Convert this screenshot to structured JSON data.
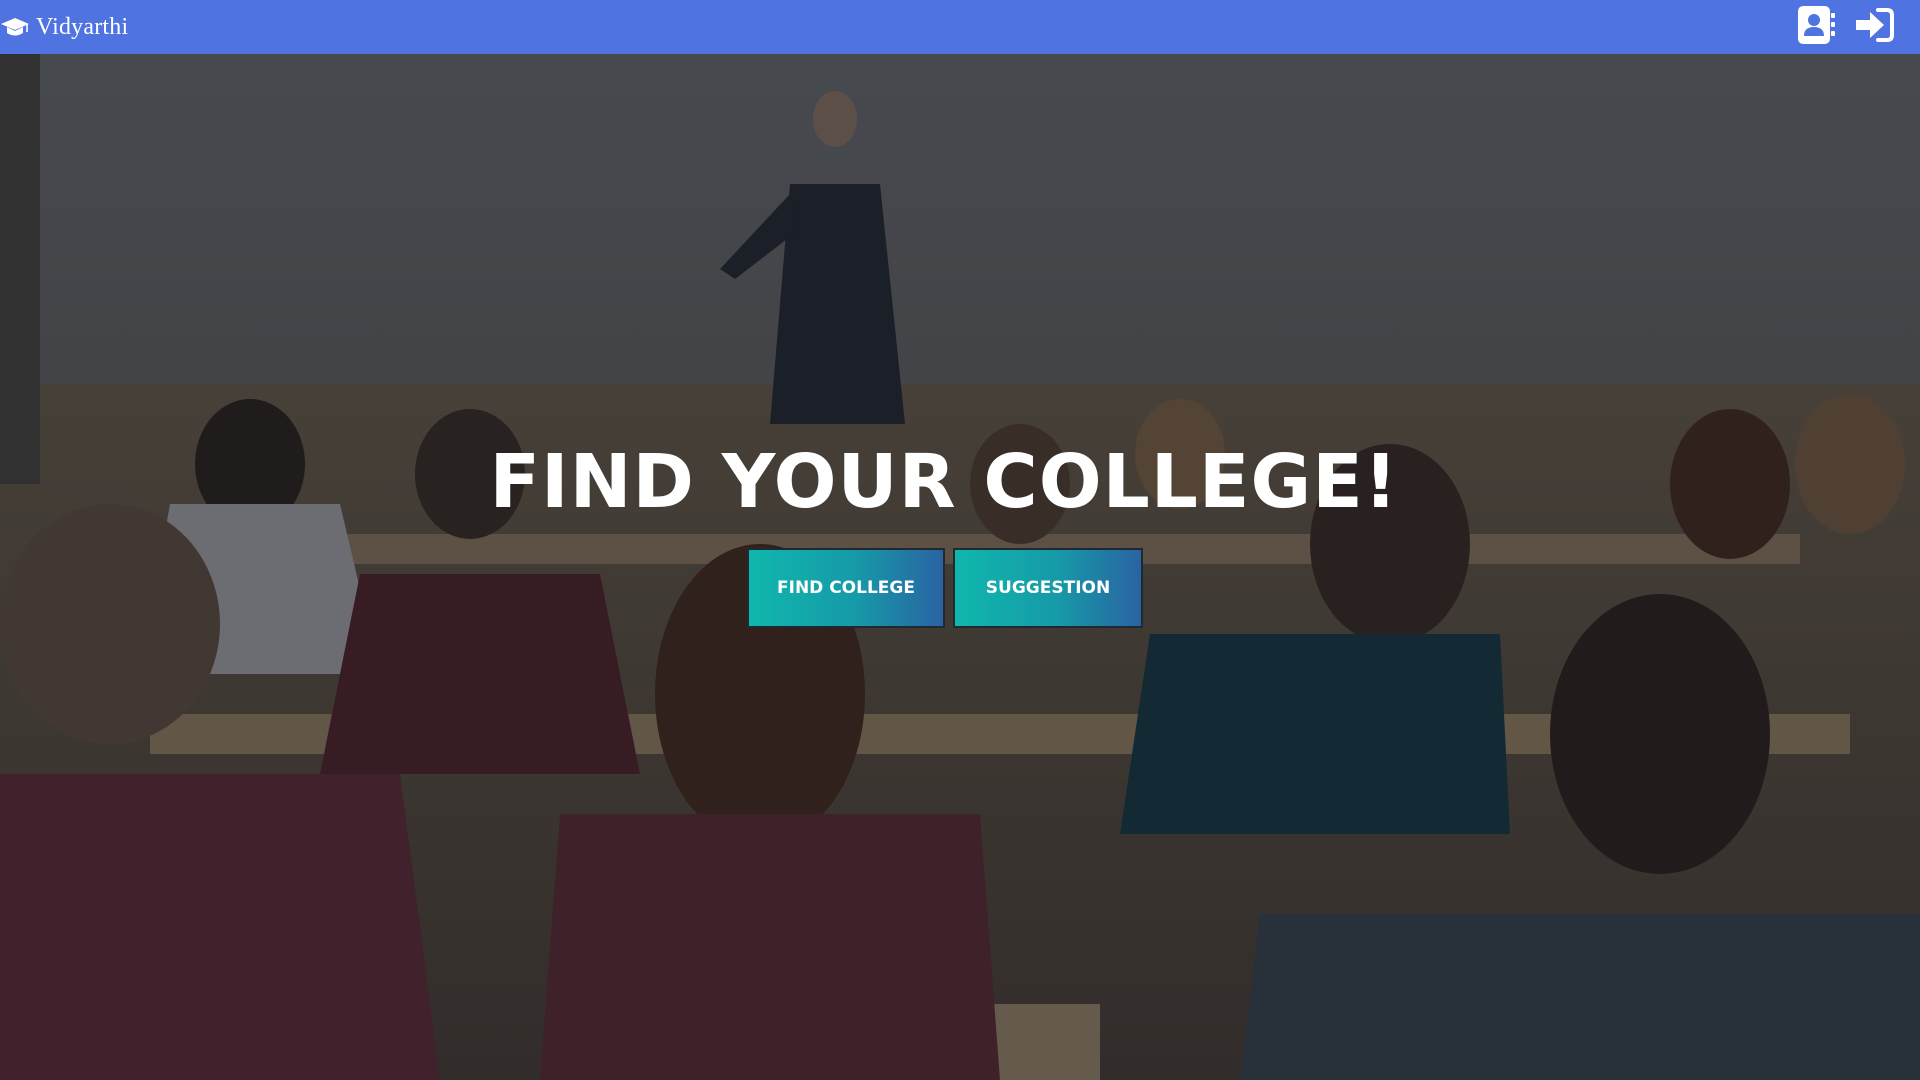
{
  "brand": {
    "name": "Vidyarthi",
    "icon": "graduation-cap-icon"
  },
  "nav": {
    "profile_icon": "contact-card-icon",
    "login_icon": "sign-in-icon"
  },
  "hero": {
    "title": "FIND YOUR COLLEGE!",
    "background": "lecture-hall-photo",
    "buttons": [
      {
        "label": "FIND COLLEGE"
      },
      {
        "label": "SUGGESTION"
      }
    ]
  },
  "colors": {
    "navbar": "#4f74e2",
    "button_gradient_start": "#10b7ad",
    "button_gradient_end": "#2a63a2",
    "title_text": "#ffffff"
  }
}
